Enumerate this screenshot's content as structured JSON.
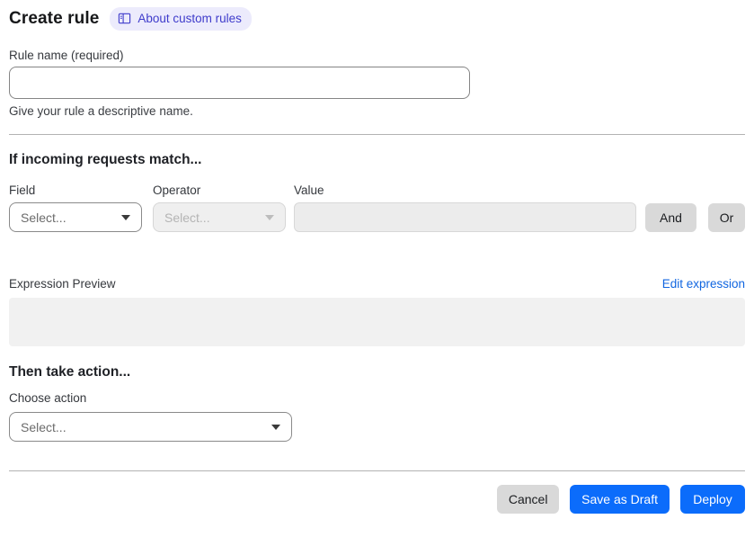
{
  "header": {
    "title": "Create rule",
    "badge_label": "About custom rules"
  },
  "rule_name": {
    "label": "Rule name (required)",
    "value": "",
    "helper": "Give your rule a descriptive name."
  },
  "match": {
    "heading": "If incoming requests match...",
    "field_label": "Field",
    "field_value": "Select...",
    "operator_label": "Operator",
    "operator_value": "Select...",
    "value_label": "Value",
    "value_text": "",
    "and_label": "And",
    "or_label": "Or"
  },
  "expression": {
    "label": "Expression Preview",
    "edit_link": "Edit expression",
    "preview_text": ""
  },
  "action": {
    "heading": "Then take action...",
    "choose_label": "Choose action",
    "select_value": "Select..."
  },
  "footer": {
    "cancel_label": "Cancel",
    "save_draft_label": "Save as Draft",
    "deploy_label": "Deploy"
  },
  "icons": {
    "badge_icon": "book-icon",
    "select_caret": "chevron-down-icon"
  },
  "colors": {
    "primary_blue": "#0b6cfb",
    "link_blue": "#1166e0",
    "badge_bg": "#ecebfc",
    "badge_text": "#3f3ccb",
    "neutral_button_bg": "#d9d9d9",
    "disabled_field_bg": "#ececec",
    "preview_box_bg": "#f1f1f1",
    "divider": "#b3b3b3"
  }
}
